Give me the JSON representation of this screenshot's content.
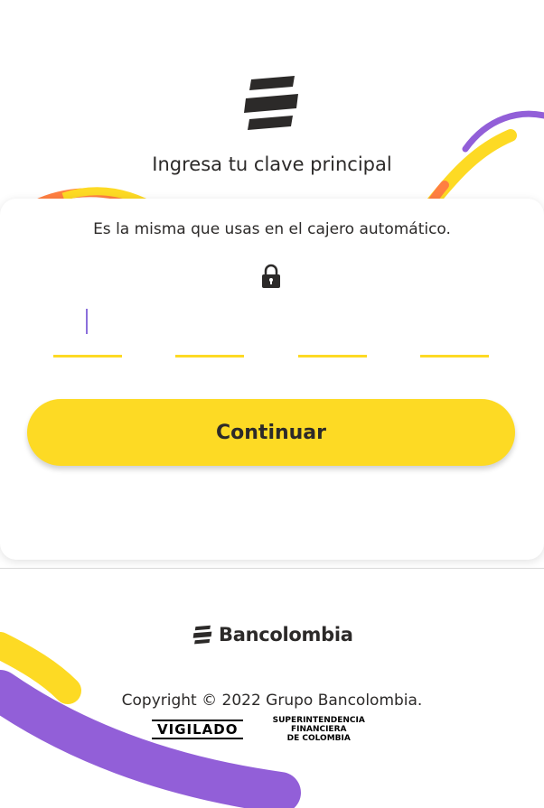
{
  "header": {
    "logo_icon": "bancolombia-stripes-icon",
    "title": "Ingresa tu clave principal"
  },
  "card": {
    "subtitle": "Es la misma que usas en el cajero automático.",
    "lock_icon": "lock-icon",
    "pin_fields": [
      "",
      "",
      "",
      ""
    ],
    "continue_label": "Continuar"
  },
  "footer": {
    "brand_name": "Bancolombia",
    "copyright": "Copyright © 2022 Grupo Bancolombia.",
    "vigilado": "VIGILADO",
    "regulator_line1": "SUPERINTENDENCIA FINANCIERA",
    "regulator_line2": "DE COLOMBIA"
  },
  "colors": {
    "accent_yellow": "#fdda24",
    "accent_purple": "#925fd8",
    "accent_orange": "#ff7f41",
    "text_dark": "#2c2a29"
  }
}
